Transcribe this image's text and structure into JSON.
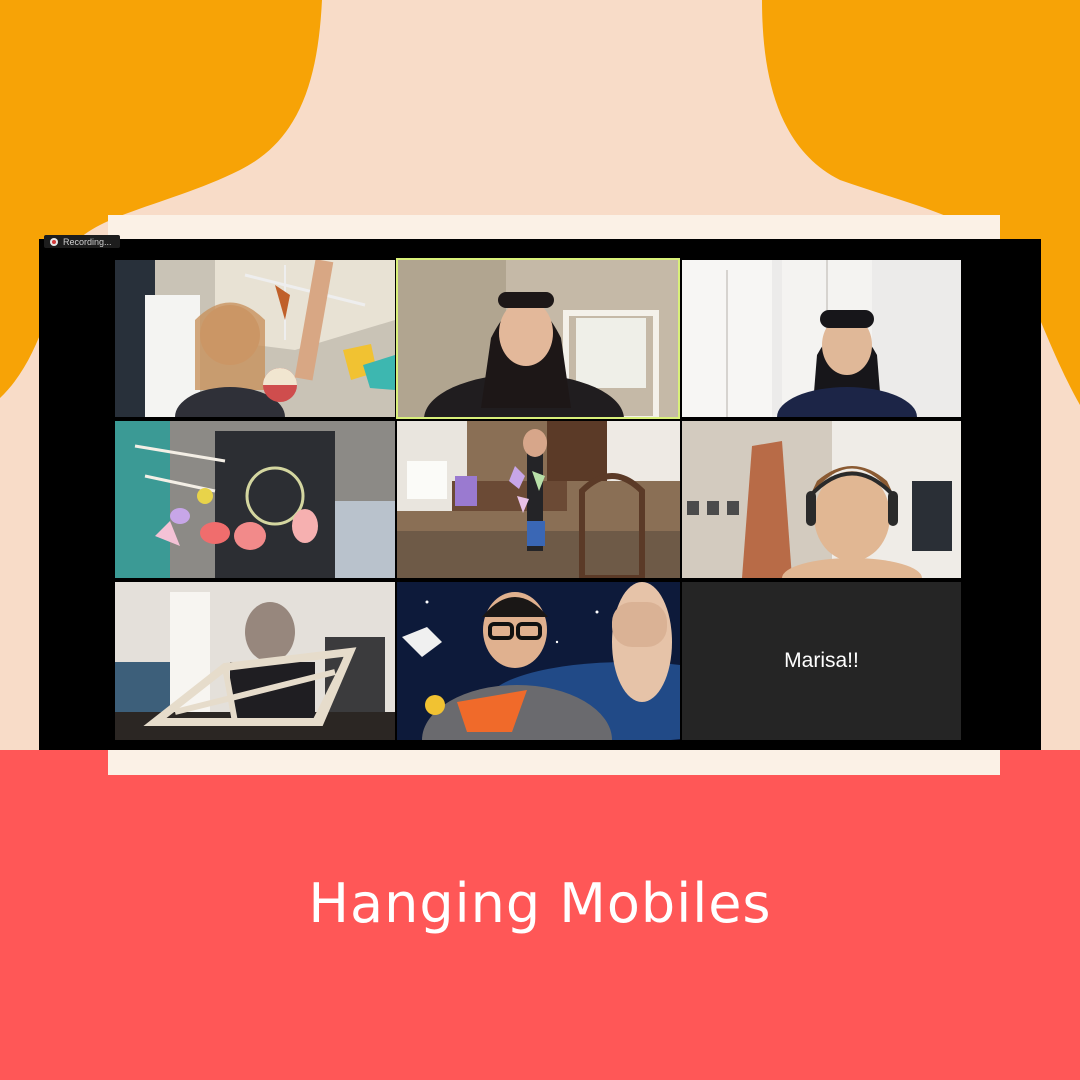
{
  "colors": {
    "background_peach": "#f8dcc8",
    "accent_orange": "#f7a306",
    "band_coral": "#ff5757",
    "frame_cream": "#fbf1e6",
    "active_speaker_border": "#d9f07a",
    "meeting_background": "#000000"
  },
  "meeting": {
    "recording_label": "Recording...",
    "tiles": [
      {
        "name": "",
        "active": false,
        "video": "girl-holding-hanging-mobile"
      },
      {
        "name": "",
        "active": true,
        "video": "smiling-girl-living-room"
      },
      {
        "name": "",
        "active": false,
        "video": "girl-in-front-of-white-doors"
      },
      {
        "name": "",
        "active": false,
        "video": "kids-showing-paper-mobiles"
      },
      {
        "name": "",
        "active": false,
        "video": "child-in-dining-room-with-mobile"
      },
      {
        "name": "",
        "active": false,
        "video": "boy-with-headphones"
      },
      {
        "name": "",
        "active": false,
        "video": "blurred-child-with-stick-mobile"
      },
      {
        "name": "",
        "active": false,
        "video": "boy-with-glasses-space-background"
      },
      {
        "name": "Marisa!!",
        "active": false,
        "video": "camera-off"
      }
    ]
  },
  "caption": {
    "title": "Hanging Mobiles"
  }
}
